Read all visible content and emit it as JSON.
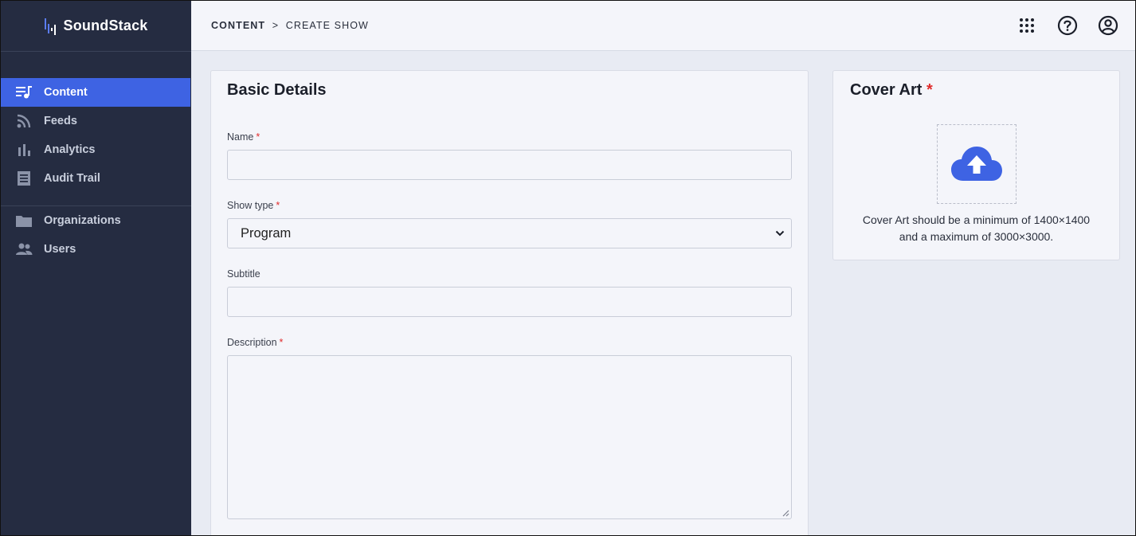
{
  "app": {
    "name": "SoundStack"
  },
  "sidebar": {
    "primary": [
      {
        "label": "Content",
        "icon": "playlist-music-icon",
        "active": true
      },
      {
        "label": "Feeds",
        "icon": "rss-icon",
        "active": false
      },
      {
        "label": "Analytics",
        "icon": "bar-chart-icon",
        "active": false
      },
      {
        "label": "Audit Trail",
        "icon": "receipt-list-icon",
        "active": false
      }
    ],
    "secondary": [
      {
        "label": "Organizations",
        "icon": "folder-icon"
      },
      {
        "label": "Users",
        "icon": "users-icon"
      }
    ]
  },
  "breadcrumb": {
    "root": "CONTENT",
    "separator": ">",
    "current": "CREATE SHOW"
  },
  "topbar": {
    "icons": [
      "apps-grid-icon",
      "help-circle-icon",
      "account-circle-icon"
    ]
  },
  "basic_details": {
    "title": "Basic Details",
    "fields": {
      "name": {
        "label": "Name",
        "required": "*",
        "value": ""
      },
      "show_type": {
        "label": "Show type",
        "required": "*",
        "value": "Program"
      },
      "subtitle": {
        "label": "Subtitle",
        "value": ""
      },
      "description": {
        "label": "Description",
        "required": "*",
        "value": ""
      }
    }
  },
  "cover_art": {
    "title": "Cover Art",
    "required": "*",
    "hint_line1": "Cover Art should be a minimum of 1400×1400",
    "hint_line2": "and a maximum of 3000×3000."
  },
  "colors": {
    "sidebar_bg": "#252c41",
    "accent": "#3e63e3",
    "required": "#e02c2c",
    "page_bg": "#e8ebf3",
    "panel_bg": "#f4f5fa"
  }
}
